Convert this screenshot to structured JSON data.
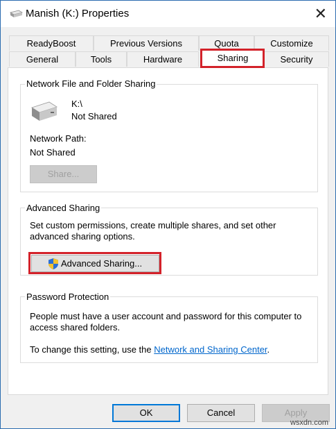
{
  "window": {
    "title": "Manish (K:) Properties"
  },
  "tabs_row1": [
    "ReadyBoost",
    "Previous Versions",
    "Quota",
    "Customize"
  ],
  "tabs_row2": [
    "General",
    "Tools",
    "Hardware",
    "Sharing",
    "Security"
  ],
  "active_tab": "Sharing",
  "network_sharing": {
    "title": "Network File and Folder Sharing",
    "drive": "K:\\",
    "status": "Not Shared",
    "path_label": "Network Path:",
    "path_value": "Not Shared",
    "share_button": "Share..."
  },
  "advanced_sharing": {
    "title": "Advanced Sharing",
    "description_line1": "Set custom permissions, create multiple shares, and set other",
    "description_line2": "advanced sharing options.",
    "button": "Advanced Sharing..."
  },
  "password_protection": {
    "title": "Password Protection",
    "line1": "People must have a user account and password for this computer to",
    "line2": "access shared folders.",
    "change_prefix": "To change this setting, use the ",
    "link": "Network and Sharing Center",
    "change_suffix": "."
  },
  "footer": {
    "ok": "OK",
    "cancel": "Cancel",
    "apply": "Apply"
  },
  "watermark": "wsxdn.com"
}
